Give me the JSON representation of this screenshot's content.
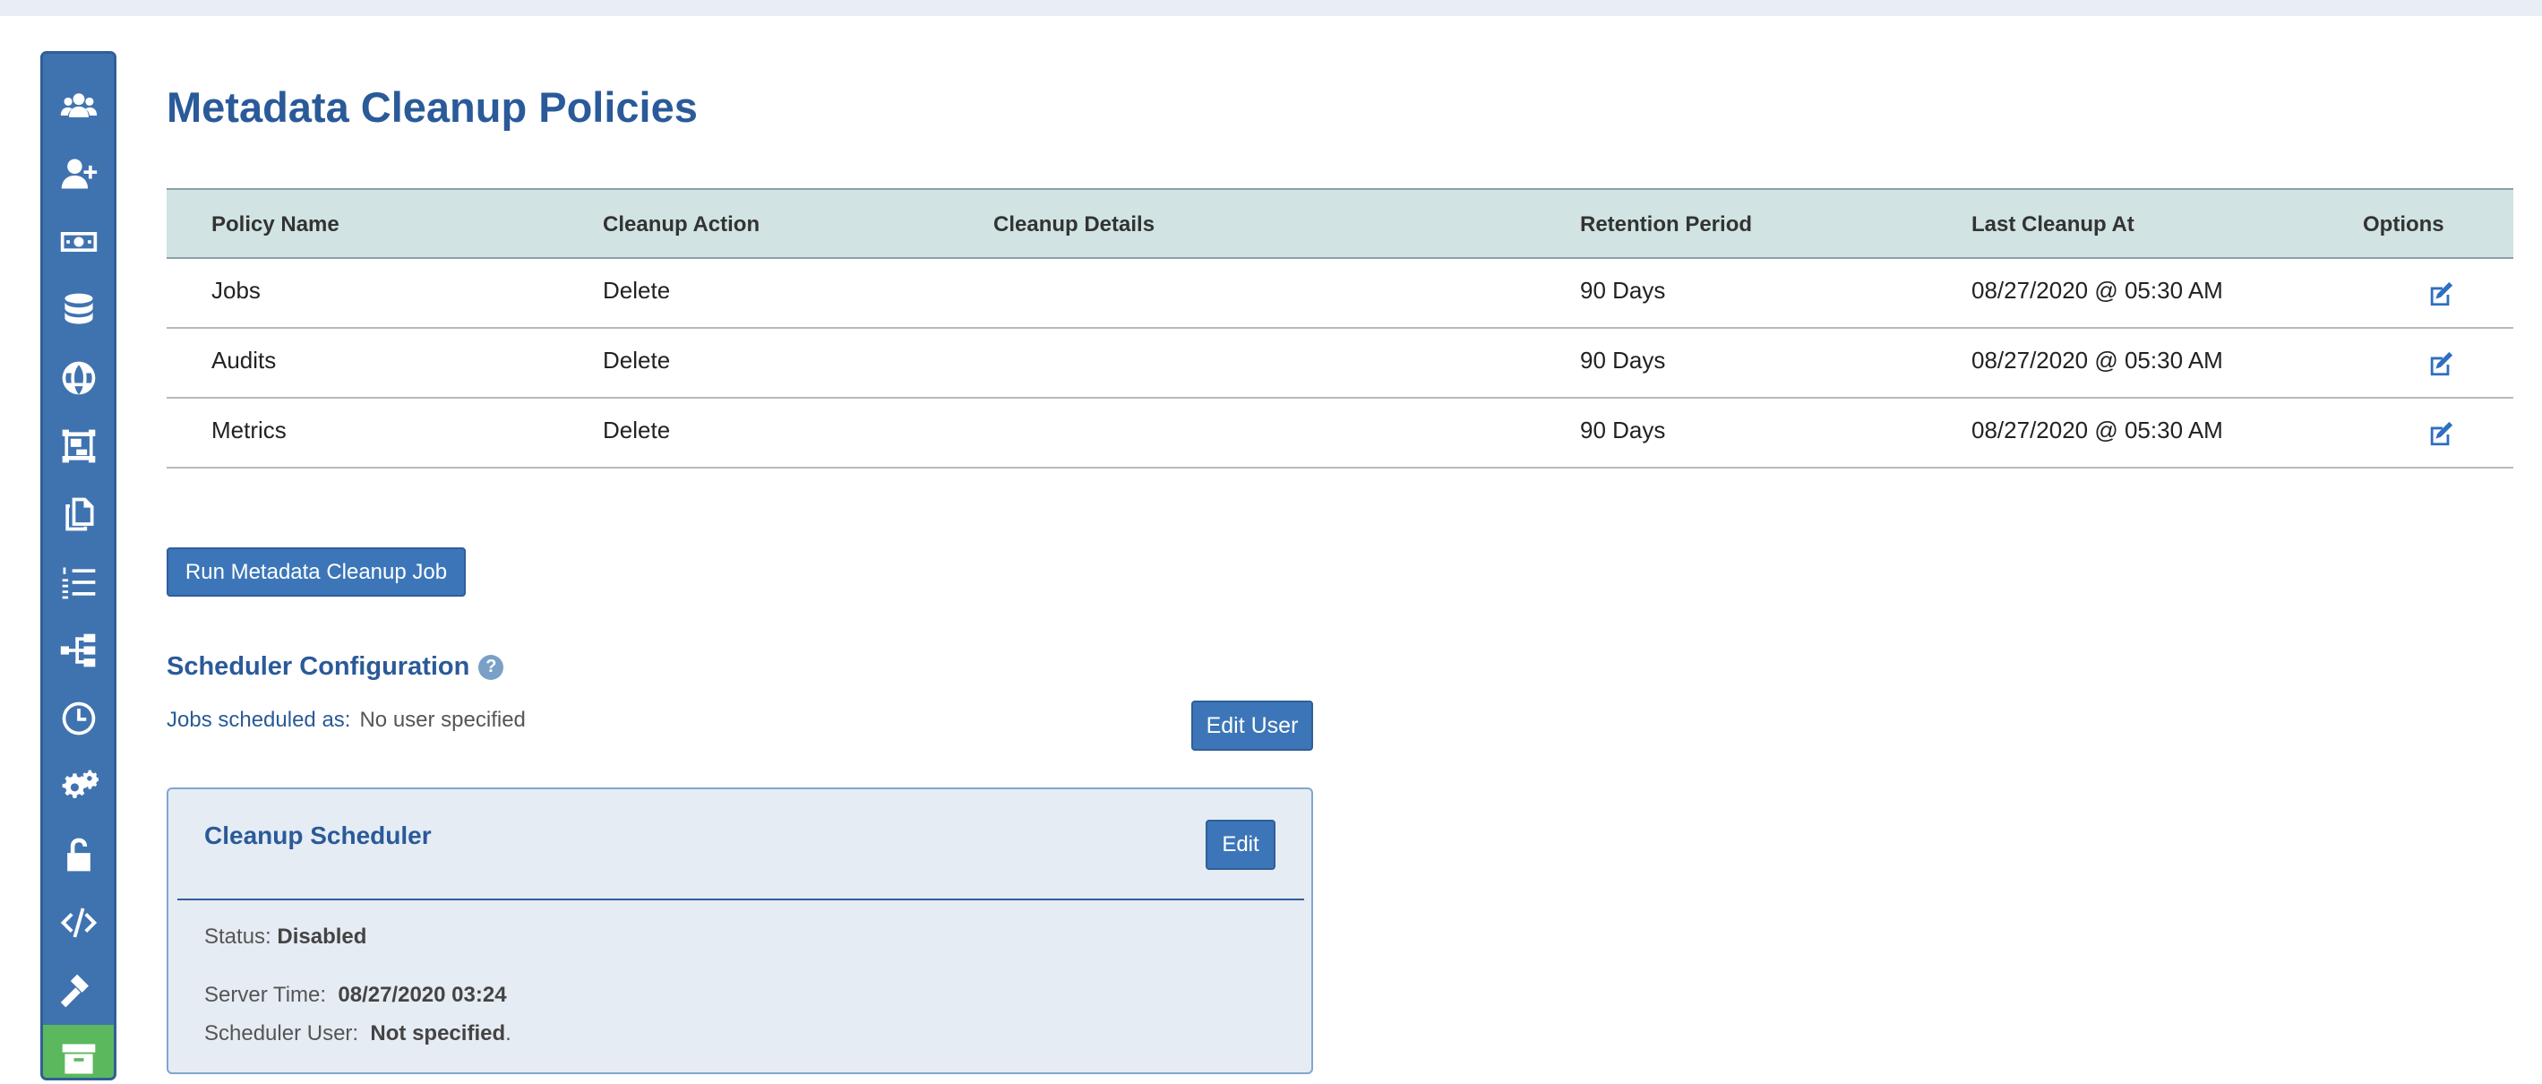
{
  "page": {
    "title": "Metadata Cleanup Policies"
  },
  "sidebar": {
    "items": [
      {
        "icon": "users-icon"
      },
      {
        "icon": "user-plus-icon"
      },
      {
        "icon": "money-icon"
      },
      {
        "icon": "database-icon"
      },
      {
        "icon": "globe-icon"
      },
      {
        "icon": "object-group-icon"
      },
      {
        "icon": "copy-icon"
      },
      {
        "icon": "list-ol-icon"
      },
      {
        "icon": "sitemap-icon"
      },
      {
        "icon": "clock-icon"
      },
      {
        "icon": "cogs-icon"
      },
      {
        "icon": "unlock-icon"
      },
      {
        "icon": "code-icon"
      },
      {
        "icon": "gavel-icon"
      },
      {
        "icon": "archive-icon",
        "active": true
      }
    ],
    "active_color": "#5cb85c",
    "background_color": "#3f73b0"
  },
  "table": {
    "headers": [
      "Policy Name",
      "Cleanup Action",
      "Cleanup Details",
      "Retention Period",
      "Last Cleanup At",
      "Options"
    ],
    "rows": [
      {
        "policy_name": "Jobs",
        "cleanup_action": "Delete",
        "cleanup_details": "",
        "retention_period": "90 Days",
        "last_cleanup_at": "08/27/2020 @ 05:30 AM",
        "option_icon": "edit-icon"
      },
      {
        "policy_name": "Audits",
        "cleanup_action": "Delete",
        "cleanup_details": "",
        "retention_period": "90 Days",
        "last_cleanup_at": "08/27/2020 @ 05:30 AM",
        "option_icon": "edit-icon"
      },
      {
        "policy_name": "Metrics",
        "cleanup_action": "Delete",
        "cleanup_details": "",
        "retention_period": "90 Days",
        "last_cleanup_at": "08/27/2020 @ 05:30 AM",
        "option_icon": "edit-icon"
      }
    ]
  },
  "actions": {
    "run_label": "Run Metadata Cleanup Job"
  },
  "scheduler_config": {
    "title": "Scheduler Configuration",
    "help_icon": "question-circle-icon",
    "jobs_label": "Jobs scheduled as:",
    "jobs_value": "No user specified",
    "edit_user_label": "Edit User"
  },
  "cleanup_scheduler": {
    "title": "Cleanup Scheduler",
    "edit_label": "Edit",
    "status_label": "Status:",
    "status_value": "Disabled",
    "server_time_label": "Server Time:",
    "server_time_value": "08/27/2020 03:24",
    "scheduler_user_label": "Scheduler User:",
    "scheduler_user_value": "Not specified",
    "scheduler_user_suffix": "."
  },
  "colors": {
    "accent": "#2a5a99",
    "button": "#3c76b8",
    "table_header": "#d1e3e3"
  }
}
